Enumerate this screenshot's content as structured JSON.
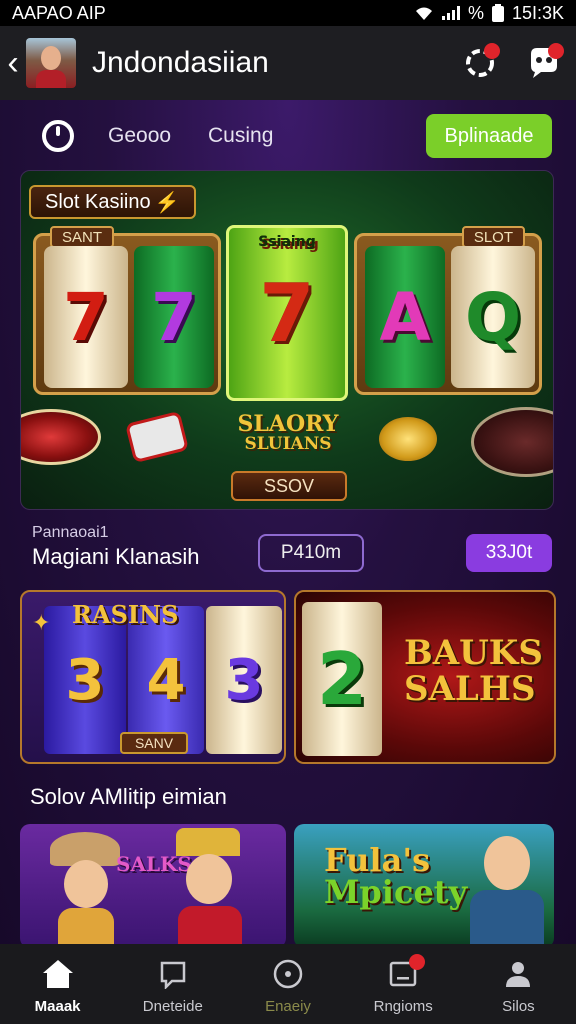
{
  "status_bar": {
    "carrier": "AAPAO AIP",
    "percent": "%",
    "time": "15I:3K"
  },
  "header": {
    "back_glyph": "‹",
    "title": "Jndondasiian"
  },
  "categories": {
    "tab_1": "Geooo",
    "tab_2": "Cusing",
    "cta": "Bplinaade"
  },
  "hero": {
    "label": "Slot Kasiino",
    "left_frame_label": "SANT",
    "right_frame_label": "SLOT",
    "center_label": "Ssiaing",
    "reel_symbols": [
      "7",
      "7",
      "7",
      "A",
      "Q"
    ],
    "banner_line_1": "SLAORY",
    "banner_line_2": "SLUIANS",
    "banner_sub": "SSOV"
  },
  "info": {
    "kicker": "Pannaoai1",
    "title": "Magiani Klanasih",
    "pill_outline": "P410m",
    "pill_solid": "33J0t"
  },
  "card_1": {
    "top_label": "RASINS",
    "symbols": [
      "3",
      "4",
      "3"
    ],
    "small_label": "SANV"
  },
  "card_2": {
    "symbol": "2",
    "label_line_1": "BAUKS",
    "label_line_2": "SALHS"
  },
  "section": {
    "title": "Solov AMlitip eimian"
  },
  "thumb_1": {
    "label": "SALKS"
  },
  "thumb_2": {
    "label_line_1": "Fula's",
    "label_line_2": "Mpicety"
  },
  "bottom_nav": {
    "items": [
      {
        "label": "Maaak"
      },
      {
        "label": "Dneteide"
      },
      {
        "label": "Enaeiy"
      },
      {
        "label": "Rngioms"
      },
      {
        "label": "Silos"
      }
    ]
  },
  "colors": {
    "accent_green": "#7bcf29",
    "accent_purple": "#8a3ce0",
    "badge_red": "#e0242b",
    "gold": "#f3c23c"
  }
}
